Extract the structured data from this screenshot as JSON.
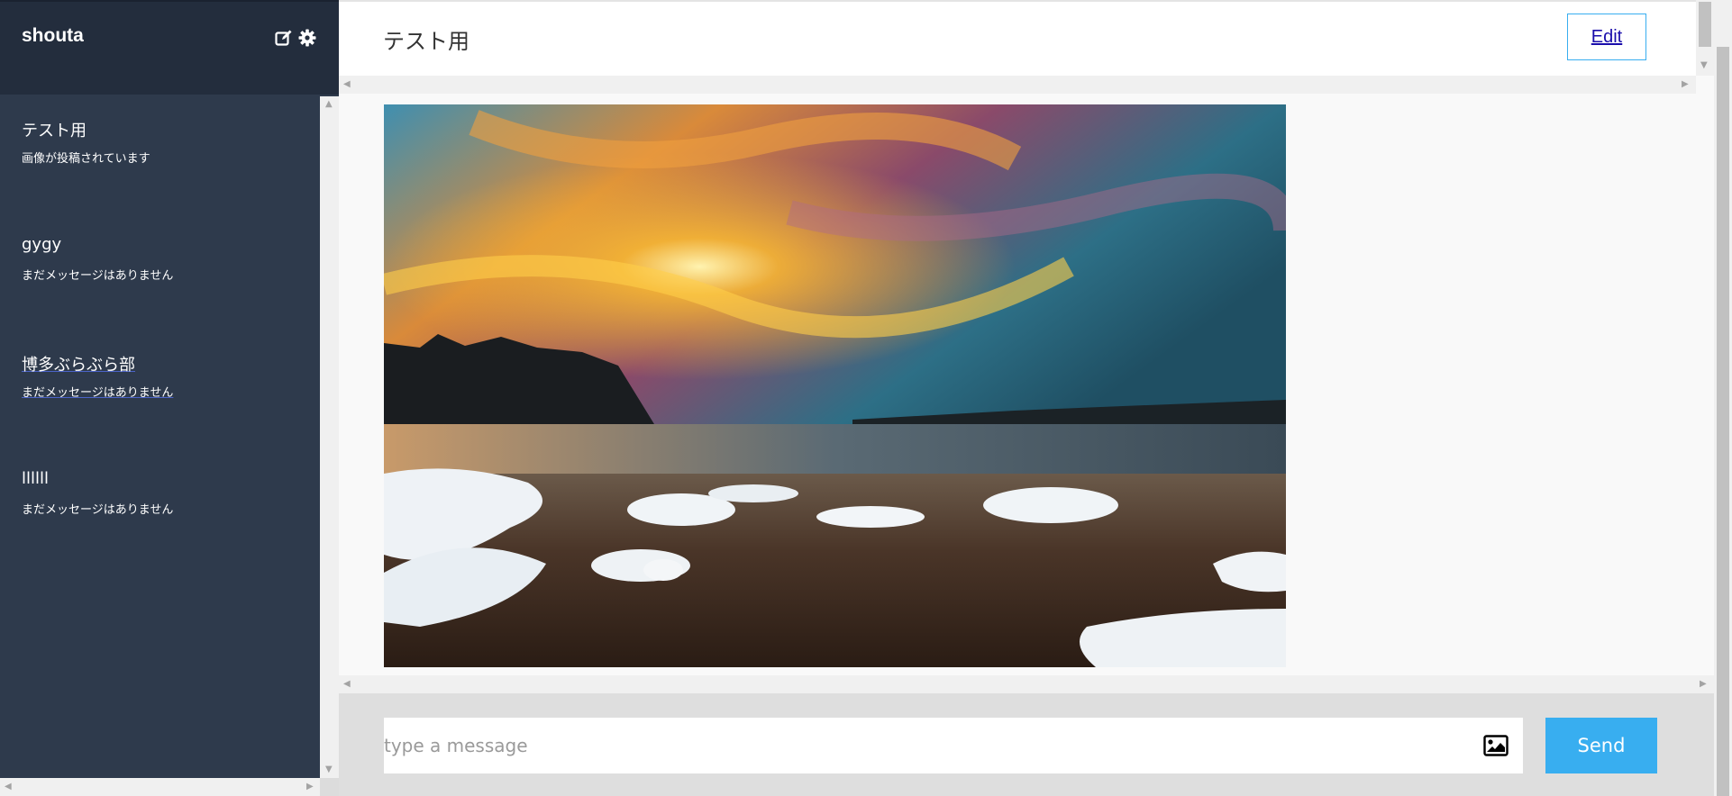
{
  "sidebar": {
    "user_name": "shouta",
    "groups": [
      {
        "name": "テスト用",
        "last_message": "画像が投稿されています"
      },
      {
        "name": "gygy",
        "last_message": "まだメッセージはありません"
      },
      {
        "name": "博多ぶらぶら部",
        "last_message": "まだメッセージはありません"
      },
      {
        "name": "llllll",
        "last_message": "まだメッセージはありません"
      }
    ]
  },
  "main": {
    "group_title": "テスト用",
    "edit_label": "Edit"
  },
  "form": {
    "message_placeholder": "type a message",
    "send_label": "Send"
  },
  "icons": {
    "edit": "edit-icon",
    "settings": "gear-icon",
    "image_upload": "image-icon"
  },
  "colors": {
    "sidebar_bg": "#2e3a4c",
    "sidebar_header_bg": "#232d3d",
    "accent": "#38aef0"
  }
}
